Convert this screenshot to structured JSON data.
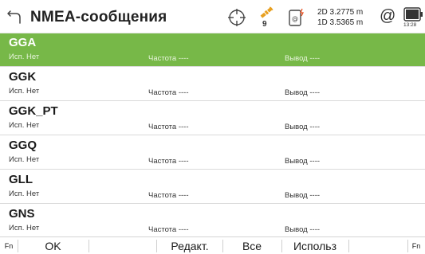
{
  "header": {
    "title": "NMEA-сообщения",
    "satellite_count": "9",
    "accuracy_2d": "2D 3.2775 m",
    "accuracy_1d": "1D 3.5365 m",
    "at_symbol": "@",
    "time": "13:28",
    "icons": [
      "back-icon",
      "crosshair-icon",
      "satellite-icon",
      "phone-link-icon",
      "at-icon",
      "battery-icon"
    ]
  },
  "list": {
    "rows": [
      {
        "name": "GGA",
        "use": "Исп.  Нет",
        "freq": "Частота  ----",
        "out": "Вывод  ----",
        "selected": true
      },
      {
        "name": "GGK",
        "use": "Исп.  Нет",
        "freq": "Частота  ----",
        "out": "Вывод  ----",
        "selected": false
      },
      {
        "name": "GGK_PT",
        "use": "Исп.  Нет",
        "freq": "Частота  ----",
        "out": "Вывод  ----",
        "selected": false
      },
      {
        "name": "GGQ",
        "use": "Исп.  Нет",
        "freq": "Частота  ----",
        "out": "Вывод  ----",
        "selected": false
      },
      {
        "name": "GLL",
        "use": "Исп.  Нет",
        "freq": "Частота  ----",
        "out": "Вывод  ----",
        "selected": false
      },
      {
        "name": "GNS",
        "use": "Исп.  Нет",
        "freq": "Частота  ----",
        "out": "Вывод  ----",
        "selected": false
      }
    ]
  },
  "toolbar": {
    "fn_left": "Fn",
    "ok": "OK",
    "edit": "Редакт.",
    "all": "Все",
    "use": "Использ",
    "fn_right": "Fn"
  },
  "colors": {
    "selected_row": "#77b848",
    "satellite_accent": "#e8a020",
    "link_accent": "#e85020"
  }
}
